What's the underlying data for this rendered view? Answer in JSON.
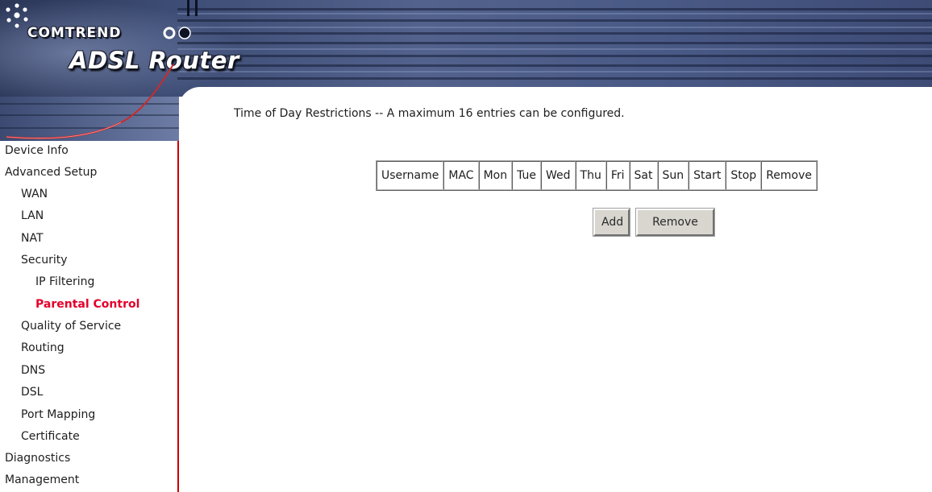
{
  "header": {
    "brand": "COMTREND",
    "product": "ADSL Router"
  },
  "sidebar": {
    "items": [
      {
        "label": "Device Info",
        "level": 1,
        "active": false
      },
      {
        "label": "Advanced Setup",
        "level": 1,
        "active": false
      },
      {
        "label": "WAN",
        "level": 2,
        "active": false
      },
      {
        "label": "LAN",
        "level": 2,
        "active": false
      },
      {
        "label": "NAT",
        "level": 2,
        "active": false
      },
      {
        "label": "Security",
        "level": 2,
        "active": false
      },
      {
        "label": "IP Filtering",
        "level": 3,
        "active": false
      },
      {
        "label": "Parental Control",
        "level": 3,
        "active": true
      },
      {
        "label": "Quality of Service",
        "level": 2,
        "active": false
      },
      {
        "label": "Routing",
        "level": 2,
        "active": false
      },
      {
        "label": "DNS",
        "level": 2,
        "active": false
      },
      {
        "label": "DSL",
        "level": 2,
        "active": false
      },
      {
        "label": "Port Mapping",
        "level": 2,
        "active": false
      },
      {
        "label": "Certificate",
        "level": 2,
        "active": false
      },
      {
        "label": "Diagnostics",
        "level": 1,
        "active": false
      },
      {
        "label": "Management",
        "level": 1,
        "active": false
      }
    ],
    "active_color": "#e4002b",
    "border_color": "#cc0000"
  },
  "main": {
    "title": "Time of Day Restrictions -- A maximum 16 entries can be configured.",
    "table": {
      "columns": [
        "Username",
        "MAC",
        "Mon",
        "Tue",
        "Wed",
        "Thu",
        "Fri",
        "Sat",
        "Sun",
        "Start",
        "Stop",
        "Remove"
      ],
      "rows": []
    },
    "buttons": {
      "add": "Add",
      "remove": "Remove"
    }
  }
}
